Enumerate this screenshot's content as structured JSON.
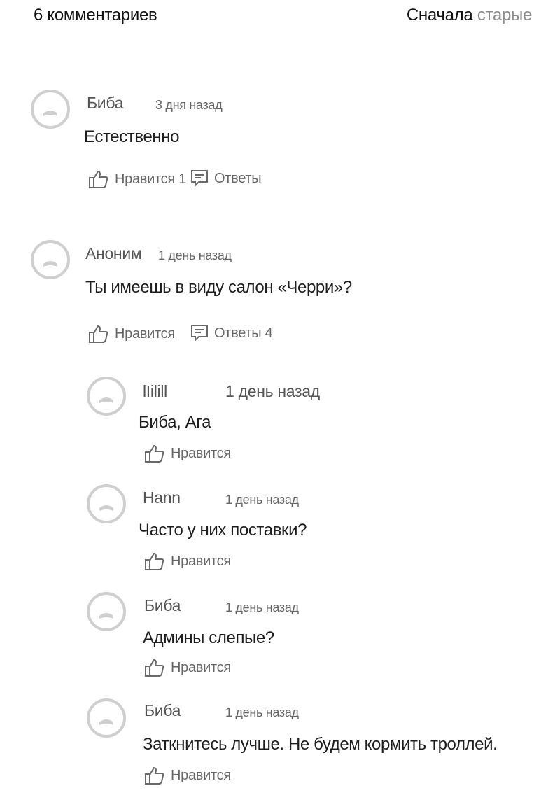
{
  "header": {
    "count_label": "6 комментариев",
    "sort_prefix": "Сначала",
    "sort_value": "старые"
  },
  "colors": {
    "avatar_ring": "#cfcfcf",
    "muted_text": "#8c8c8c",
    "text": "#1e1e1e"
  },
  "icons": {
    "like": "thumbs-up-icon",
    "replies": "comment-icon",
    "avatar": "default-avatar-icon"
  },
  "comments": [
    {
      "author": "Биба",
      "time": "3 дня назад",
      "text": "Естественно",
      "like_label": "Нравится 1",
      "replies_label": "Ответы"
    },
    {
      "author": "Аноним",
      "time": "1 день назад",
      "text": "Ты имеешь в виду салон «Черри»?",
      "like_label": "Нравится",
      "replies_label": "Ответы 4",
      "replies": [
        {
          "author": "lIilill",
          "time": "1 день назад",
          "text": "Биба, Ага",
          "like_label": "Нравится"
        },
        {
          "author": "Hann",
          "time": "1 день назад",
          "text": "Часто у них поставки?",
          "like_label": "Нравится"
        },
        {
          "author": "Биба",
          "time": "1 день назад",
          "text": "Админы слепые?",
          "like_label": "Нравится"
        },
        {
          "author": "Биба",
          "time": "1 день назад",
          "text": "Заткнитесь лучше. Не будем кормить троллей.",
          "like_label": "Нравится"
        }
      ]
    }
  ]
}
